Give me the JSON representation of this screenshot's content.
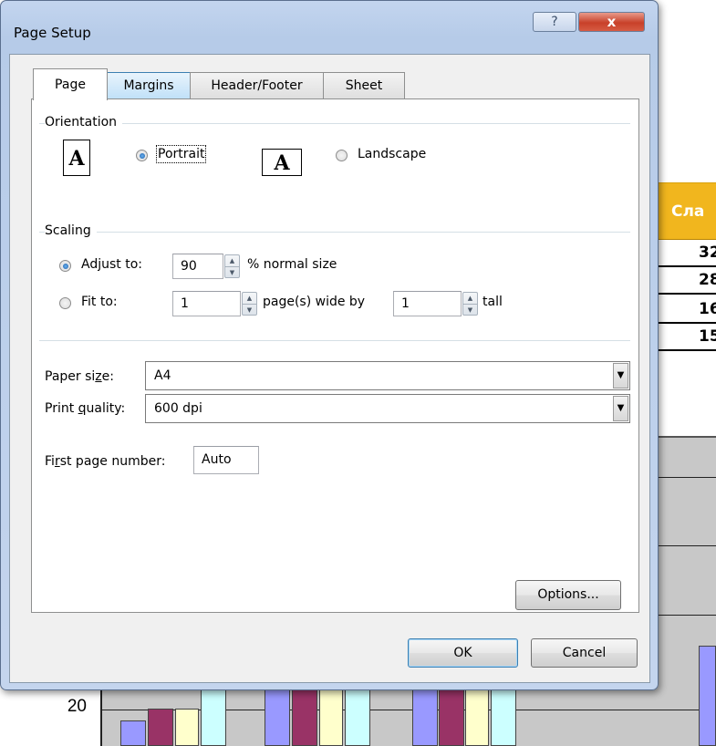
{
  "dialog": {
    "title": "Page Setup",
    "help_glyph": "?",
    "close_glyph": "x",
    "tabs": [
      {
        "label": "Page",
        "active": true
      },
      {
        "label": "Margins",
        "active": false
      },
      {
        "label": "Header/Footer",
        "active": false
      },
      {
        "label": "Sheet",
        "active": false
      }
    ],
    "orientation": {
      "group_label": "Orientation",
      "icon_glyph": "A",
      "portrait_label": "Portrait",
      "landscape_label": "Landscape",
      "selected": "Portrait"
    },
    "scaling": {
      "group_label": "Scaling",
      "adjust_label": "Adjust to:",
      "adjust_value": "90",
      "adjust_suffix": "% normal size",
      "fit_label": "Fit to:",
      "fit_wide_value": "1",
      "fit_wide_suffix": "page(s) wide by",
      "fit_tall_value": "1",
      "fit_tall_suffix": "tall",
      "selected": "Adjust to:"
    },
    "paper_size": {
      "label": "Paper size:",
      "value": "A4"
    },
    "print_quality": {
      "label": "Print quality:",
      "value": "600 dpi"
    },
    "first_page_number": {
      "label": "First page number:",
      "value": "Auto"
    },
    "options_label": "Options...",
    "ok_label": "OK",
    "cancel_label": "Cancel"
  },
  "background": {
    "header_text": "Сла",
    "row_values": [
      "32",
      "28",
      "16",
      "15"
    ],
    "axis_tick_label": "20",
    "header_color": "#f1b61e",
    "series_colors": [
      "#9999ff",
      "#993366",
      "#ffffcc",
      "#ccffff"
    ]
  }
}
